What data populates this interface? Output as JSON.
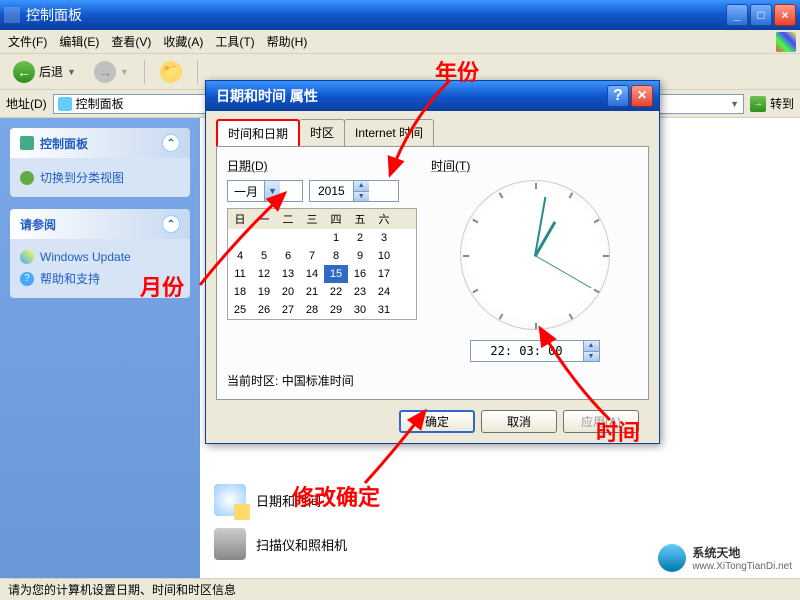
{
  "window": {
    "title": "控制面板"
  },
  "menu": {
    "file": "文件(F)",
    "edit": "编辑(E)",
    "view": "查看(V)",
    "favorites": "收藏(A)",
    "tools": "工具(T)",
    "help": "帮助(H)"
  },
  "toolbar": {
    "back": "后退"
  },
  "address": {
    "label": "地址(D)",
    "value": "控制面板",
    "go": "转到"
  },
  "sidebar": {
    "panel1": {
      "title": "控制面板",
      "link1": "切换到分类视图"
    },
    "panel2": {
      "title": "请参阅",
      "link1": "Windows Update",
      "link2": "帮助和支持"
    }
  },
  "cpitems": {
    "datetime": "日期和时间",
    "scanner": "扫描仪和照相机"
  },
  "dialog": {
    "title": "日期和时间 属性",
    "tab1": "时间和日期",
    "tab2": "时区",
    "tab3": "Internet 时间",
    "date_label": "日期(D)",
    "time_label": "时间(T)",
    "month": "一月",
    "year": "2015",
    "weekdays": [
      "日",
      "一",
      "二",
      "三",
      "四",
      "五",
      "六"
    ],
    "days": [
      "",
      "",
      "",
      "",
      "1",
      "2",
      "3",
      "4",
      "5",
      "6",
      "7",
      "8",
      "9",
      "10",
      "11",
      "12",
      "13",
      "14",
      "15",
      "16",
      "17",
      "18",
      "19",
      "20",
      "21",
      "22",
      "23",
      "24",
      "25",
      "26",
      "27",
      "28",
      "29",
      "30",
      "31"
    ],
    "selected_day": "15",
    "time_value": "22: 03: 00",
    "tz_label": "当前时区:",
    "tz_value": "中国标准时间",
    "ok": "确定",
    "cancel": "取消",
    "apply": "应用(A)"
  },
  "annotations": {
    "year": "年份",
    "month": "月份",
    "time": "时间",
    "confirm": "修改确定"
  },
  "statusbar": "请为您的计算机设置日期、时间和时区信息",
  "watermark": {
    "name": "系统天地",
    "url": "www.XiTongTianDi.net"
  }
}
